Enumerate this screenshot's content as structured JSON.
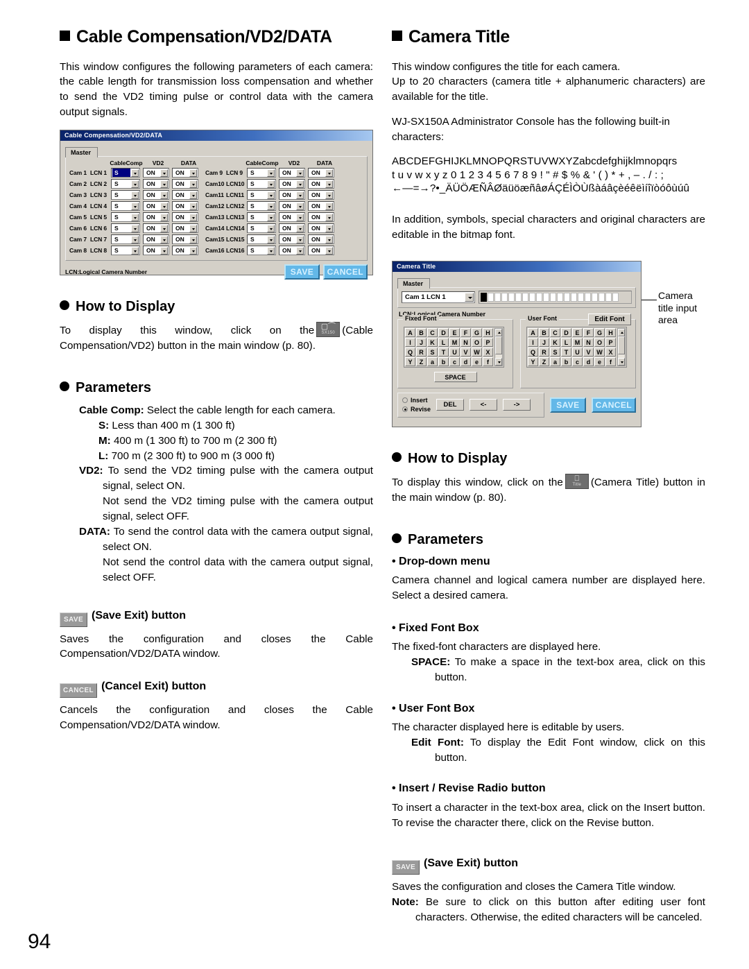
{
  "page": {
    "number": "94"
  },
  "left": {
    "heading": "Cable Compensation/VD2/DATA",
    "intro": "This window configures the following parameters of each camera: the cable length for transmission loss compensation and whether to send the VD2 timing pulse or control data with the camera output signals.",
    "dialog": {
      "title": "Cable Compensation/VD2/DATA",
      "tab": "Master",
      "headers": {
        "cable_comp": "CableComp",
        "vd2": "VD2",
        "data": "DATA"
      },
      "rows_left": [
        {
          "cam": "Cam 1",
          "lcn": "LCN 1",
          "cable": "S",
          "vd2": "ON",
          "data": "ON",
          "selected": true
        },
        {
          "cam": "Cam 2",
          "lcn": "LCN 2",
          "cable": "S",
          "vd2": "ON",
          "data": "ON",
          "selected": false
        },
        {
          "cam": "Cam 3",
          "lcn": "LCN 3",
          "cable": "S",
          "vd2": "ON",
          "data": "ON",
          "selected": false
        },
        {
          "cam": "Cam 4",
          "lcn": "LCN 4",
          "cable": "S",
          "vd2": "ON",
          "data": "ON",
          "selected": false
        },
        {
          "cam": "Cam 5",
          "lcn": "LCN 5",
          "cable": "S",
          "vd2": "ON",
          "data": "ON",
          "selected": false
        },
        {
          "cam": "Cam 6",
          "lcn": "LCN 6",
          "cable": "S",
          "vd2": "ON",
          "data": "ON",
          "selected": false
        },
        {
          "cam": "Cam 7",
          "lcn": "LCN 7",
          "cable": "S",
          "vd2": "ON",
          "data": "ON",
          "selected": false
        },
        {
          "cam": "Cam 8",
          "lcn": "LCN 8",
          "cable": "S",
          "vd2": "ON",
          "data": "ON",
          "selected": false
        }
      ],
      "rows_right": [
        {
          "cam": "Cam 9",
          "lcn": "LCN 9",
          "cable": "S",
          "vd2": "ON",
          "data": "ON"
        },
        {
          "cam": "Cam10",
          "lcn": "LCN10",
          "cable": "S",
          "vd2": "ON",
          "data": "ON"
        },
        {
          "cam": "Cam11",
          "lcn": "LCN11",
          "cable": "S",
          "vd2": "ON",
          "data": "ON"
        },
        {
          "cam": "Cam12",
          "lcn": "LCN12",
          "cable": "S",
          "vd2": "ON",
          "data": "ON"
        },
        {
          "cam": "Cam13",
          "lcn": "LCN13",
          "cable": "S",
          "vd2": "ON",
          "data": "ON"
        },
        {
          "cam": "Cam14",
          "lcn": "LCN14",
          "cable": "S",
          "vd2": "ON",
          "data": "ON"
        },
        {
          "cam": "Cam15",
          "lcn": "LCN15",
          "cable": "S",
          "vd2": "ON",
          "data": "ON"
        },
        {
          "cam": "Cam16",
          "lcn": "LCN16",
          "cable": "S",
          "vd2": "ON",
          "data": "ON"
        }
      ],
      "footnote": "LCN:Logical Camera Number",
      "save_label": "SAVE",
      "cancel_label": "CANCEL"
    },
    "how_to_display": {
      "heading": "How to Display",
      "text_a": "To display this window, click on the",
      "icon_label": "SX150",
      "text_b": "(Cable Compensation/VD2) button in the main window (p. 80)."
    },
    "parameters": {
      "heading": "Parameters",
      "cable_comp_label": "Cable Comp:",
      "cable_comp_text": "Select the cable length for each camera.",
      "s_label": "S:",
      "s_text": "Less than 400 m (1 300 ft)",
      "m_label": "M:",
      "m_text": "400 m (1 300 ft) to 700 m (2 300 ft)",
      "l_label": "L:",
      "l_text": "700 m (2 300 ft) to 900 m (3 000 ft)",
      "vd2_label": "VD2:",
      "vd2_text": "To send the VD2 timing pulse with the camera output signal, select ON.",
      "vd2_text2": "Not send the VD2 timing pulse with the camera output signal, select OFF.",
      "data_label": "DATA:",
      "data_text": "To send the control data with the camera output signal, select ON.",
      "data_text2": "Not send the control data with the camera output signal, select OFF."
    },
    "save_btn": {
      "chip": "SAVE",
      "heading": "(Save Exit) button",
      "text": "Saves the configuration and closes the Cable Compensation/VD2/DATA window."
    },
    "cancel_btn": {
      "chip": "CANCEL",
      "heading": "(Cancel Exit) button",
      "text": "Cancels the configuration and closes the Cable Compensation/VD2/DATA window."
    }
  },
  "right": {
    "heading": "Camera Title",
    "intro1": "This window configures the title for each camera.",
    "intro2": "Up to 20 characters (camera title + alphanumeric characters) are available for the title.",
    "builtin_intro": "WJ-SX150A Administrator Console has the following built-in characters:",
    "charset_line1": "ABCDEFGHIJKLMNOPQRSTUVWXYZabcdefghijklmnopqrs",
    "charset_line2": "t u v w x y z 0 1 2 3 4 5 6 7 8 9 ! \" # $ % & ' ( ) * + , – . / : ;",
    "charset_line3": "←—=→?•_ÄÜÖÆÑÂØäüöæñâøÁÇÉÌÒÙßàáâçèéêëìíîïòóôùúû",
    "addition": "In addition, symbols, special characters and original characters are editable in the bitmap font.",
    "dialog": {
      "title": "Camera Title",
      "tab": "Master",
      "camera_select": "Cam 1   LCN 1",
      "footnote": "LCN:Logical Camera Number",
      "fixed_font_legend": "Fixed Font",
      "user_font_legend": "User Font",
      "edit_font_label": "Edit Font",
      "keys": [
        "A",
        "B",
        "C",
        "D",
        "E",
        "F",
        "G",
        "H",
        "I",
        "J",
        "K",
        "L",
        "M",
        "N",
        "O",
        "P",
        "Q",
        "R",
        "S",
        "T",
        "U",
        "V",
        "W",
        "X",
        "Y",
        "Z",
        "a",
        "b",
        "c",
        "d",
        "e",
        "f"
      ],
      "space_label": "SPACE",
      "insert_label": "Insert",
      "revise_label": "Revise",
      "del_label": "DEL",
      "left_label": "<-",
      "right_label": "->",
      "save_label": "SAVE",
      "cancel_label": "CANCEL"
    },
    "callout": "Camera title input area",
    "how_to_display": {
      "heading": "How to Display",
      "text_a": "To display this window, click on the",
      "icon_label": "Title",
      "text_b": "(Camera Title) button in the main window (p. 80)."
    },
    "parameters": {
      "heading": "Parameters",
      "dropdown_heading": "• Drop-down menu",
      "dropdown_text": "Camera channel and logical camera number are displayed here. Select a desired camera.",
      "fixed_heading": "• Fixed Font Box",
      "fixed_text": "The fixed-font characters are displayed here.",
      "space_label": "SPACE:",
      "space_text": "To make a space in the text-box area, click on this button.",
      "user_heading": "• User Font Box",
      "user_text": "The character displayed here is editable by users.",
      "editfont_label": "Edit Font:",
      "editfont_text": "To display the Edit Font window, click on this button.",
      "radio_heading": "• Insert / Revise Radio button",
      "radio_text": "To insert a character in the text-box area, click on the Insert button. To revise the character there, click on the Revise button."
    },
    "save_btn": {
      "chip": "SAVE",
      "heading": "(Save Exit) button",
      "text": "Saves the configuration and closes the Camera Title window.",
      "note_label": "Note:",
      "note_text": "Be sure to click on this button after editing user font characters. Otherwise, the edited characters will be canceled."
    }
  }
}
